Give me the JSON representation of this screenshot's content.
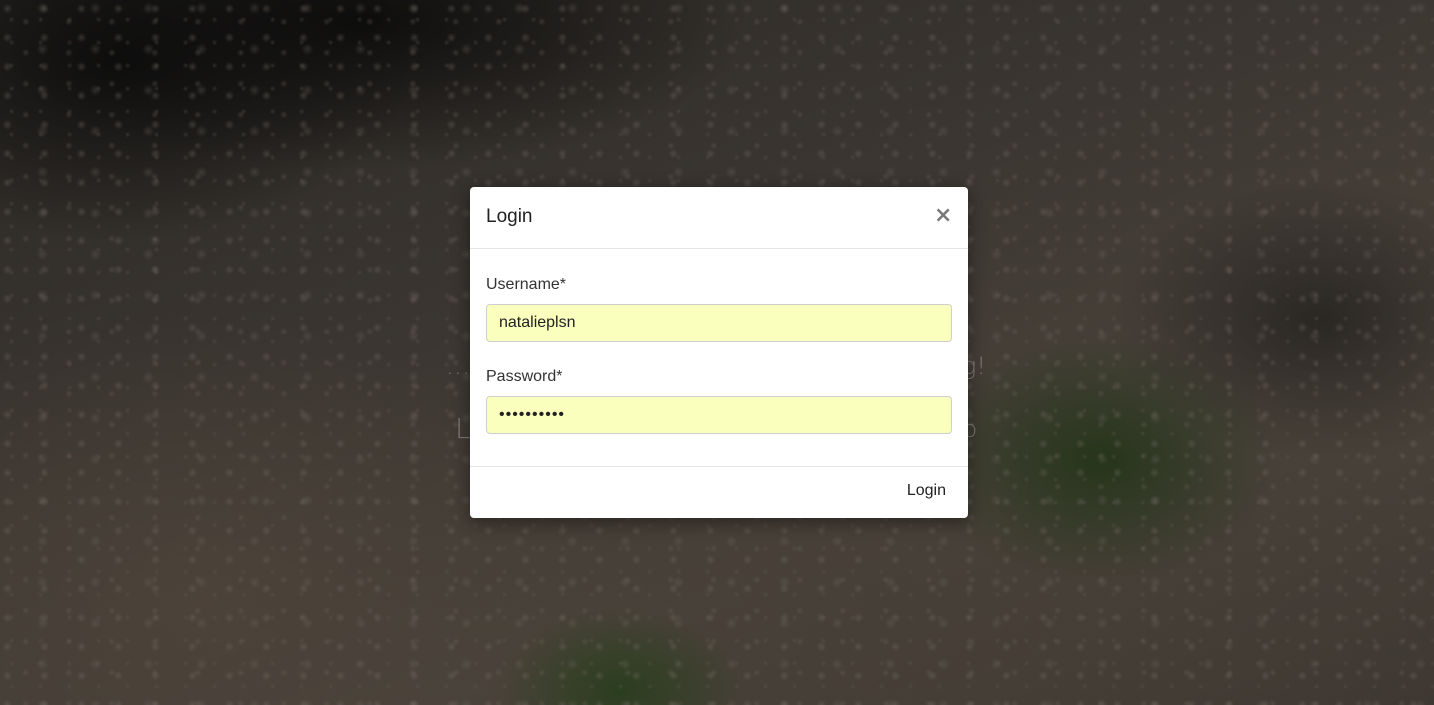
{
  "background": {
    "tagline_start": "...t",
    "tagline_end": "g!",
    "line2_start": "L",
    "line2_end": "p"
  },
  "modal": {
    "title": "Login",
    "close_symbol": "×",
    "username": {
      "label": "Username*",
      "value": "natalieplsn"
    },
    "password": {
      "label": "Password*",
      "value": "••••••••••"
    },
    "submit_label": "Login",
    "autofill_color": "#faffbd"
  }
}
